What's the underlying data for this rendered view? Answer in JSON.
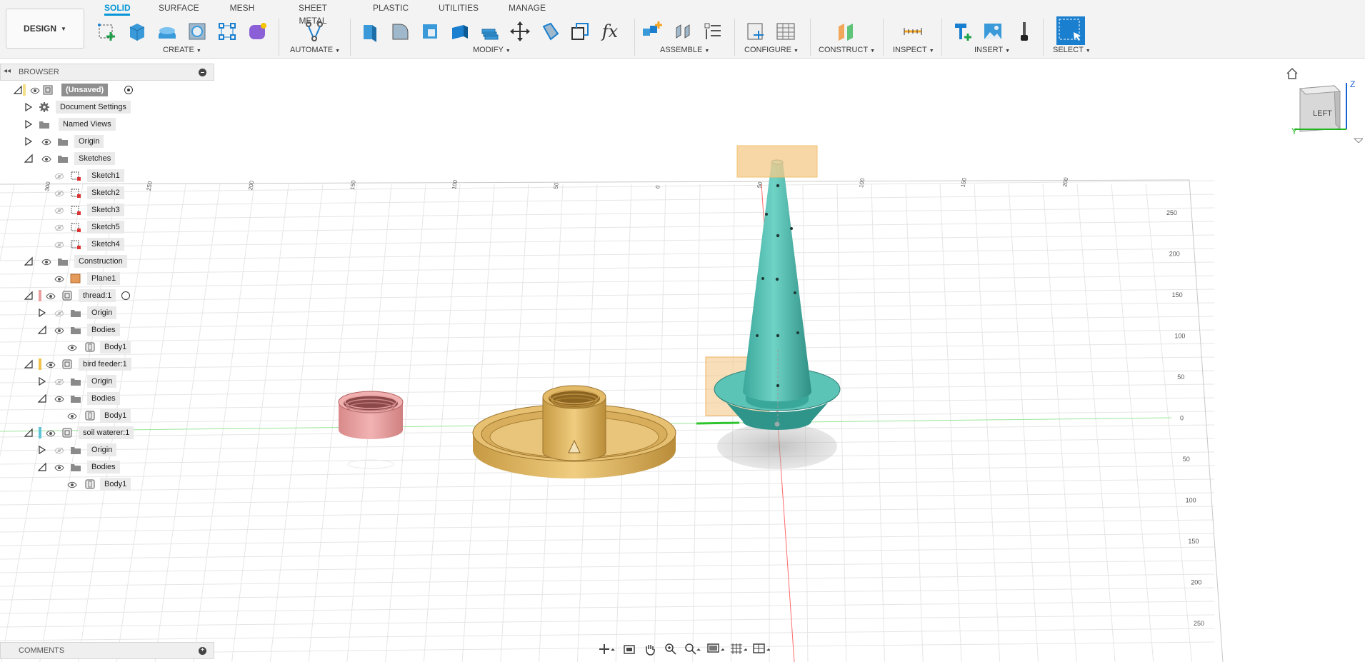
{
  "toolbar": {
    "workspace": "DESIGN",
    "tabs": [
      "SOLID",
      "SURFACE",
      "MESH",
      "SHEET METAL",
      "PLASTIC",
      "UTILITIES",
      "MANAGE"
    ],
    "active_tab": "SOLID",
    "groups": {
      "create": "CREATE",
      "automate": "AUTOMATE",
      "modify": "MODIFY",
      "assemble": "ASSEMBLE",
      "configure": "CONFIGURE",
      "construct": "CONSTRUCT",
      "inspect": "INSPECT",
      "insert": "INSERT",
      "select": "SELECT"
    },
    "modify_fx": "fx"
  },
  "browser": {
    "title": "BROWSER",
    "items": [
      {
        "label": "(Unsaved)"
      },
      {
        "label": "Document Settings"
      },
      {
        "label": "Named Views"
      },
      {
        "label": "Origin"
      },
      {
        "label": "Sketches"
      },
      {
        "label": "Sketch1"
      },
      {
        "label": "Sketch2"
      },
      {
        "label": "Sketch3"
      },
      {
        "label": "Sketch5"
      },
      {
        "label": "Sketch4"
      },
      {
        "label": "Construction"
      },
      {
        "label": "Plane1"
      },
      {
        "label": "thread:1"
      },
      {
        "label": "Origin"
      },
      {
        "label": "Bodies"
      },
      {
        "label": "Body1"
      },
      {
        "label": "bird feeder:1"
      },
      {
        "label": "Origin"
      },
      {
        "label": "Bodies"
      },
      {
        "label": "Body1"
      },
      {
        "label": "soil waterer:1"
      },
      {
        "label": "Origin"
      },
      {
        "label": "Bodies"
      },
      {
        "label": "Body1"
      }
    ]
  },
  "comments": {
    "title": "COMMENTS"
  },
  "viewcube": {
    "face": "LEFT",
    "axis_z": "Z",
    "axis_y": "Y"
  },
  "ruler": {
    "top": [
      "300",
      "250",
      "200",
      "150",
      "100",
      "50",
      "0",
      "50",
      "100",
      "150",
      "200"
    ],
    "right": [
      "250",
      "200",
      "150",
      "100",
      "50",
      "0",
      "50",
      "100",
      "150",
      "200",
      "250"
    ]
  },
  "colors": {
    "accent": "#0696d7",
    "thread_body": "#e8a0a0",
    "bird_feeder_body": "#e2bd6a",
    "soil_waterer_body": "#5fc4b8",
    "plane": "#f5c98a",
    "x_axis": "#ff6b6b",
    "y_axis": "#44d144"
  }
}
